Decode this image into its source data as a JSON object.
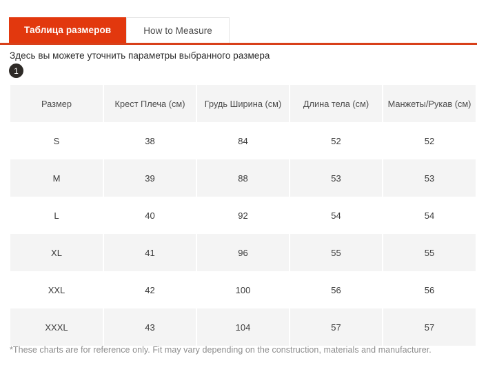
{
  "tabs": [
    {
      "label": "Таблица размеров",
      "active": true
    },
    {
      "label": "How to Measure",
      "active": false
    }
  ],
  "subtitle": "Здесь вы можете уточнить параметры выбранного размера",
  "step_badge": "1",
  "table": {
    "headers": [
      "Размер",
      "Крест Плеча (см)",
      "Грудь Ширина (см)",
      "Длина тела (см)",
      "Манжеты/Рукав (см)"
    ],
    "rows": [
      [
        "S",
        "38",
        "84",
        "52",
        "52"
      ],
      [
        "M",
        "39",
        "88",
        "53",
        "53"
      ],
      [
        "L",
        "40",
        "92",
        "54",
        "54"
      ],
      [
        "XL",
        "41",
        "96",
        "55",
        "55"
      ],
      [
        "XXL",
        "42",
        "100",
        "56",
        "56"
      ],
      [
        "XXXL",
        "43",
        "104",
        "57",
        "57"
      ]
    ]
  },
  "footnote": "*These charts are for reference only. Fit may vary depending on the construction, materials and manufacturer.",
  "colors": {
    "accent": "#e2380e",
    "underline": "#d8401a",
    "header_cell": "#f4f4f4",
    "badge": "#2e2a27"
  }
}
